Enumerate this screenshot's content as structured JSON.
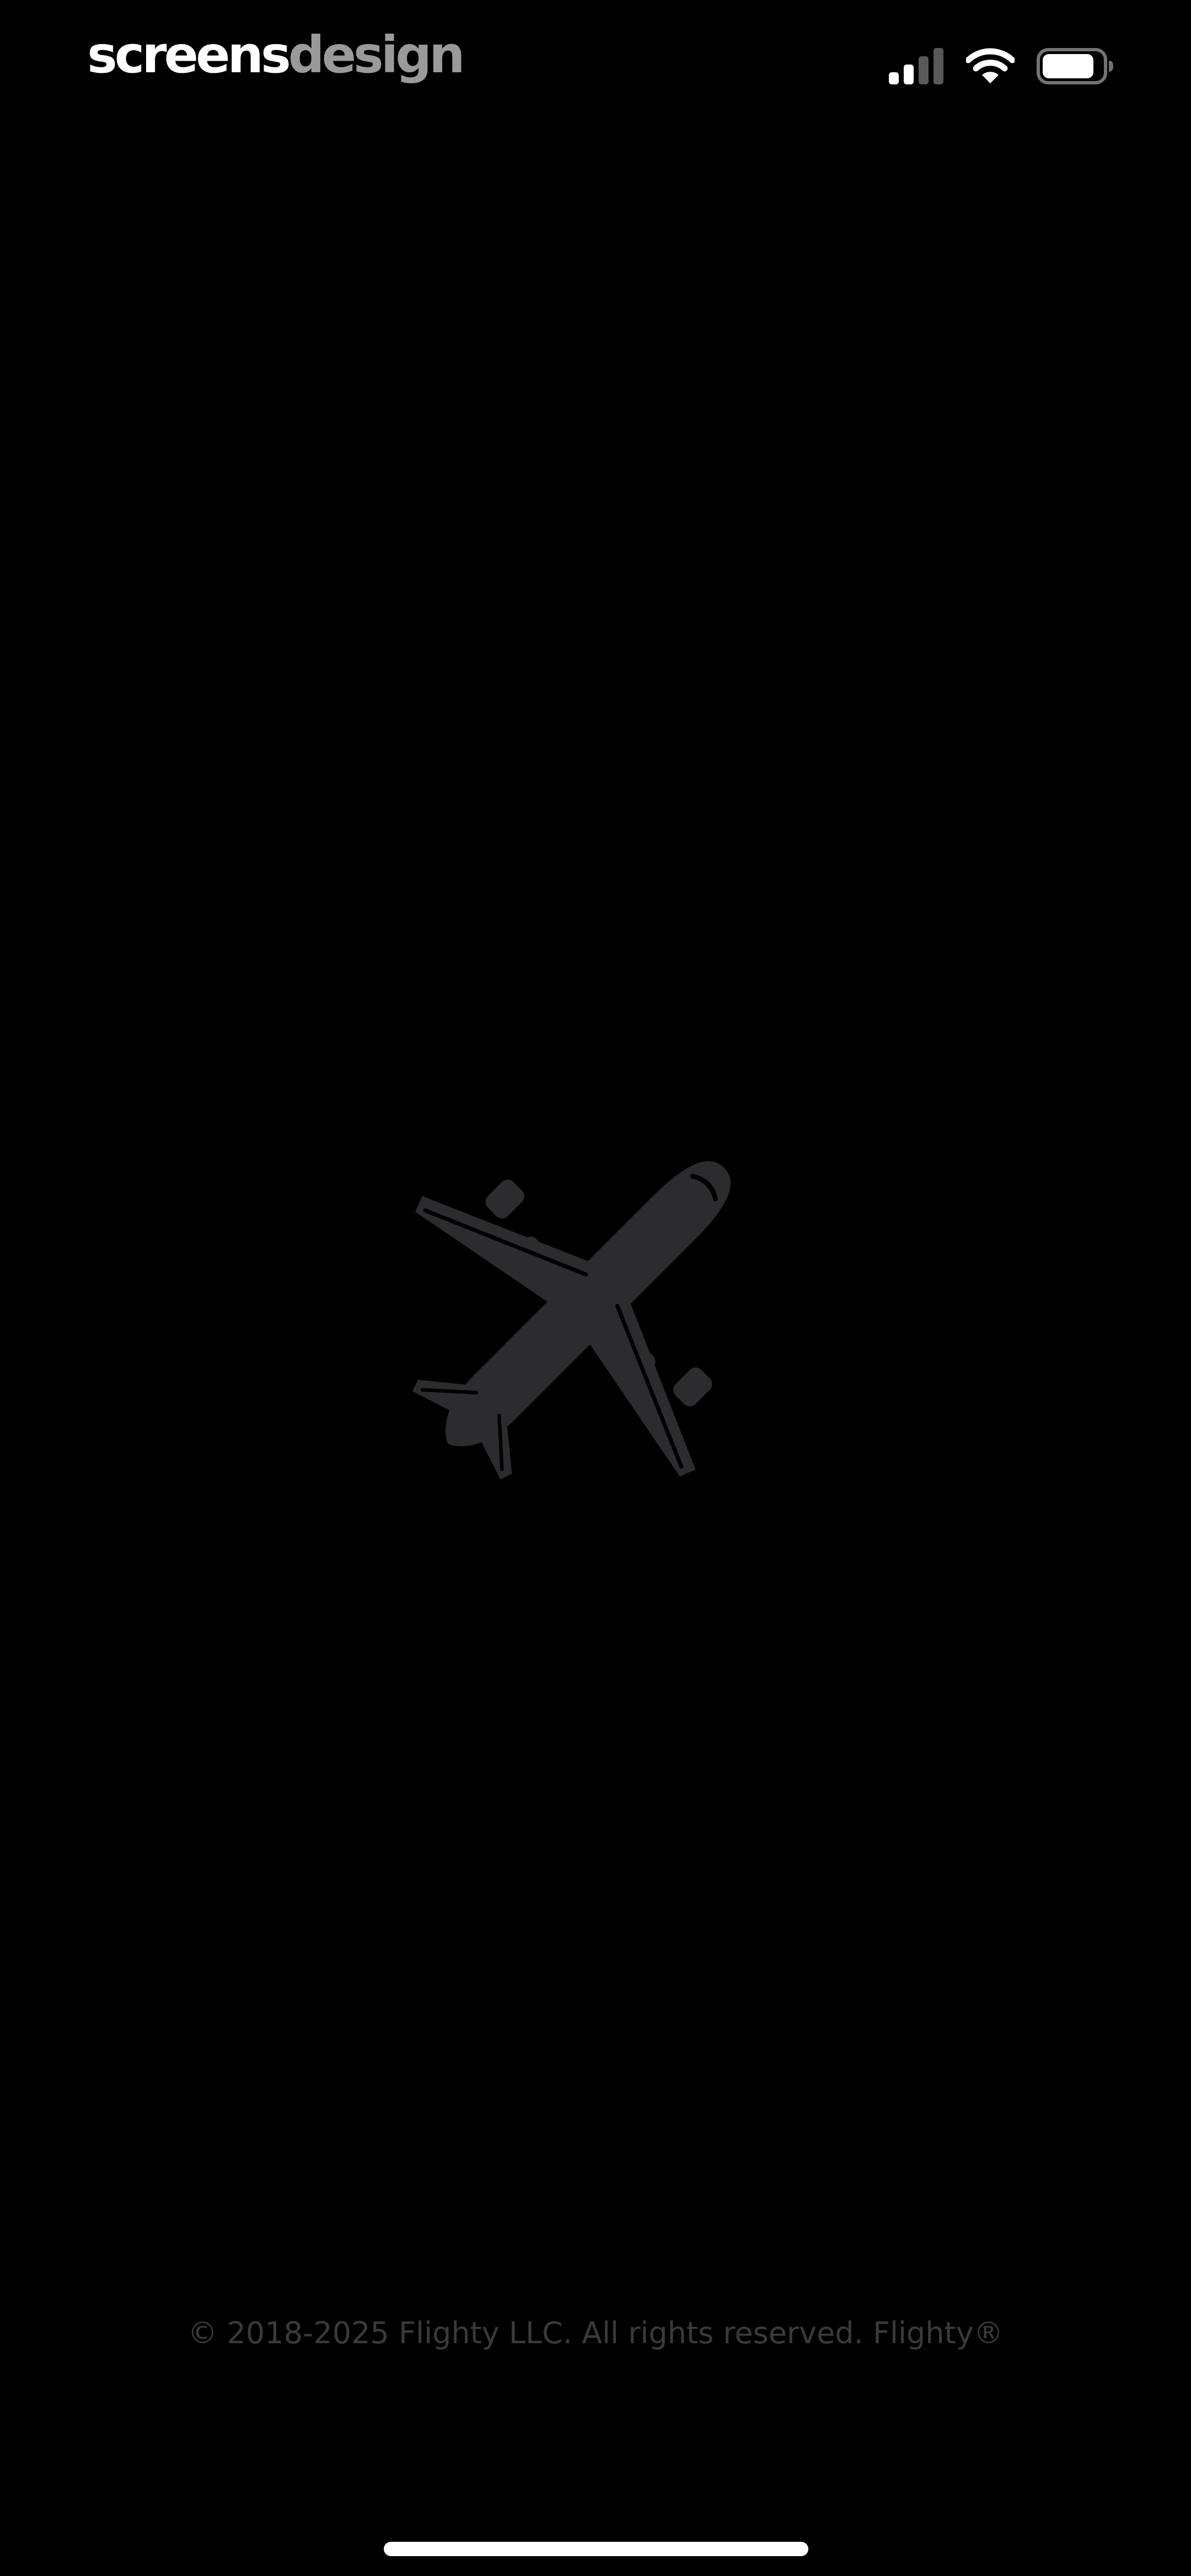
{
  "status_bar": {
    "brand_part_1": "screens",
    "brand_part_2": "design",
    "signal_icon": "cellular-signal-icon",
    "signal_active_bars": 2,
    "signal_total_bars": 4,
    "wifi_icon": "wifi-icon",
    "battery_icon": "battery-icon",
    "battery_level": 0.85
  },
  "hero": {
    "icon": "airplane-icon",
    "color": "#2c2c2e"
  },
  "footer": {
    "copyright": "© 2018-2025 Flighty LLC. All rights reserved. Flighty®"
  },
  "colors": {
    "background": "#000000",
    "brand_primary": "#ffffff",
    "brand_secondary": "#9a9a9a",
    "footer_text": "#3a3a3c",
    "plane": "#2c2c2e"
  }
}
